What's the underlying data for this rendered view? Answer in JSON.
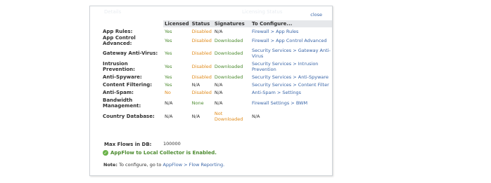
{
  "dialog": {
    "title_ghost": "Details",
    "header_ghost": "Licensing Status",
    "close_label": "close"
  },
  "table": {
    "headers": [
      "",
      "Licensed",
      "Status",
      "Signatures",
      "To Configure..."
    ],
    "rows": [
      {
        "label": "App Rules:",
        "licensed": "Yes",
        "status": "Disabled",
        "signatures": "N/A",
        "configure": "Firewall > App Rules"
      },
      {
        "label": "App Control Advanced:",
        "licensed": "Yes",
        "status": "Disabled",
        "signatures": "Downloaded",
        "configure": "Firewall > App Control Advanced"
      },
      {
        "label": "Gateway Anti-Virus:",
        "licensed": "Yes",
        "status": "Disabled",
        "signatures": "Downloaded",
        "configure": "Security Services > Gateway Anti-Virus"
      },
      {
        "label": "Intrusion Prevention:",
        "licensed": "Yes",
        "status": "Disabled",
        "signatures": "Downloaded",
        "configure": "Security Services > Intrusion Prevention"
      },
      {
        "label": "Anti-Spyware:",
        "licensed": "Yes",
        "status": "Disabled",
        "signatures": "Downloaded",
        "configure": "Security Services > Anti-Spyware"
      },
      {
        "label": "Content Filtering:",
        "licensed": "Yes",
        "status": "N/A",
        "signatures": "N/A",
        "configure": "Security Services > Content Filter"
      },
      {
        "label": "Anti-Spam:",
        "licensed": "No",
        "status": "Disabled",
        "signatures": "N/A",
        "configure": "Anti-Spam > Settings"
      },
      {
        "label": "Bandwidth Management:",
        "licensed": "N/A",
        "status": "None",
        "signatures": "N/A",
        "configure": "Firewall Settings > BWM"
      },
      {
        "label": "Country Database:",
        "licensed": "N/A",
        "status": "N/A",
        "signatures": "Not Downloaded",
        "configure": "N/A"
      }
    ]
  },
  "max_flows": {
    "label": "Max Flows in DB:",
    "value": "100000"
  },
  "appflow": {
    "status_text": "AppFlow to Local Collector is Enabled."
  },
  "note": {
    "prefix": "Note:",
    "text": "To configure, go to",
    "link": "AppFlow > Flow Reporting."
  },
  "colors": {
    "yes": "#4b8a2e",
    "warning": "#e08b1b",
    "link": "#3a66a8",
    "header_bg": "#e6e8eb"
  }
}
